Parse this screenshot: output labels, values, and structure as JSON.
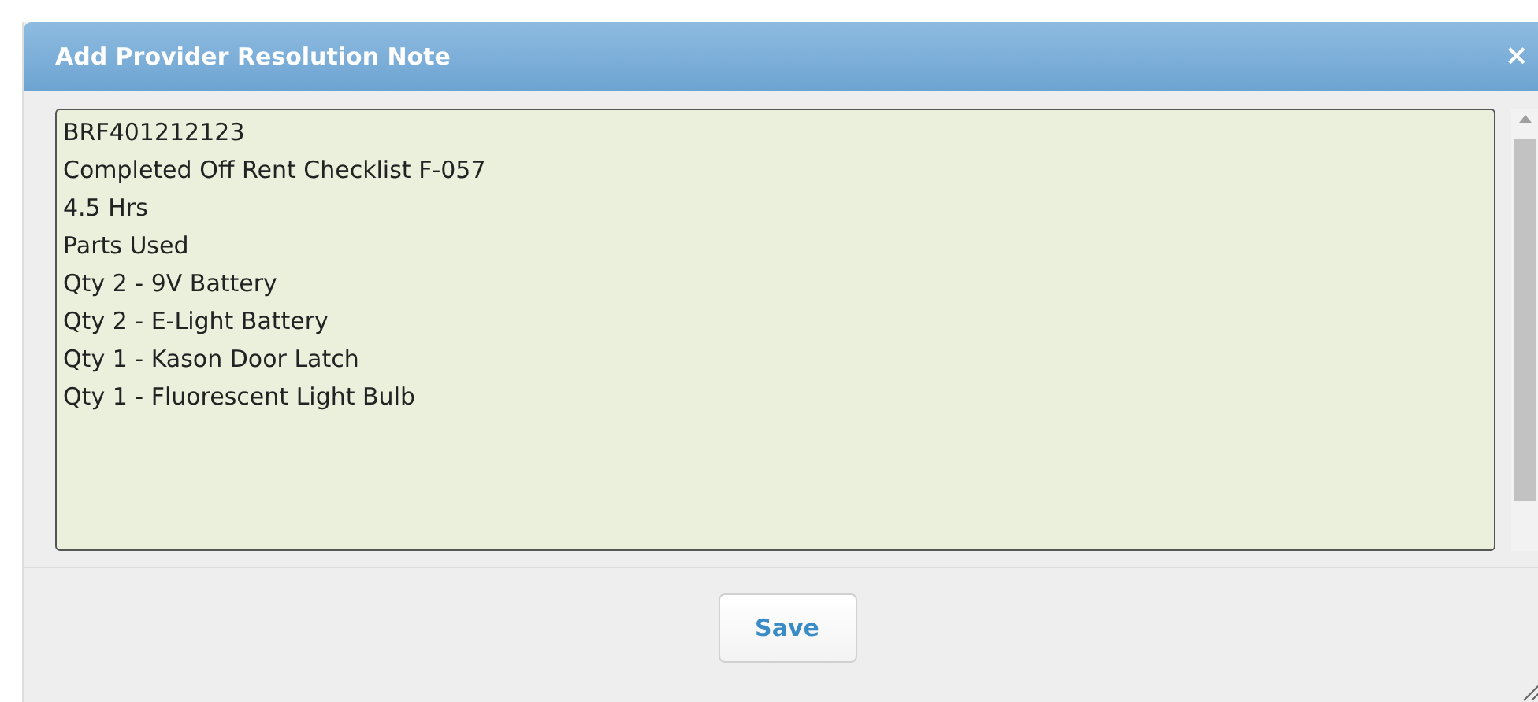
{
  "dialog": {
    "title": "Add Provider Resolution Note",
    "close_label": "×"
  },
  "note": {
    "lines": [
      "BRF401212123",
      "Completed Off Rent Checklist F-057",
      "4.5 Hrs",
      "Parts Used",
      "Qty 2 - 9V Battery",
      "Qty 2 - E-Light Battery",
      "Qty 1 - Kason Door Latch",
      "Qty 1 - Fluorescent Light Bulb"
    ]
  },
  "buttons": [
    "Save"
  ]
}
